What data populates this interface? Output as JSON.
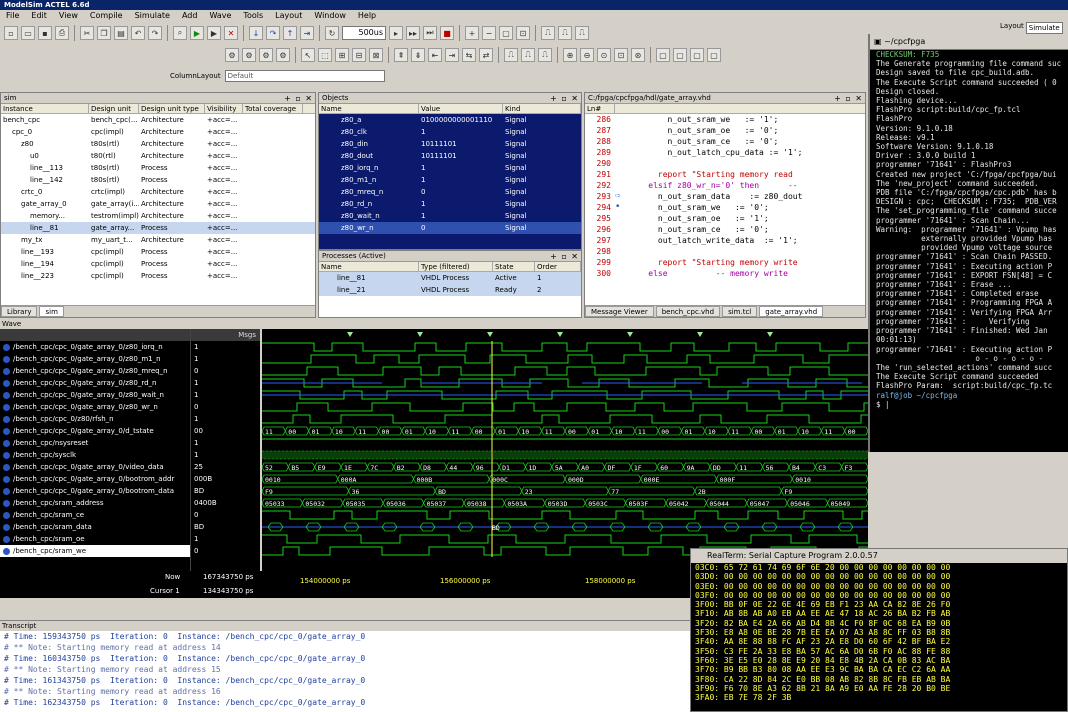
{
  "app": {
    "title": "ModelSim ACTEL 6.6d"
  },
  "menu": [
    "File",
    "Edit",
    "View",
    "Compile",
    "Simulate",
    "Add",
    "Wave",
    "Tools",
    "Layout",
    "Window",
    "Help"
  ],
  "toolbar": {
    "run_length": "500us",
    "column_layout_label": "ColumnLayout",
    "column_layout_value": "Default",
    "layout_label": "Layout",
    "layout_value": "Simulate"
  },
  "sim_pane": {
    "title": "sim",
    "columns": [
      "Instance",
      "Design unit",
      "Design unit type",
      "Visibility",
      "Total coverage"
    ],
    "rows": [
      [
        "bench_cpc",
        "bench_cpc(...",
        "Architecture",
        "+acc=...",
        ""
      ],
      [
        "cpc_0",
        "cpc(impl)",
        "Architecture",
        "+acc=...",
        ""
      ],
      [
        "z80",
        "t80s(rtl)",
        "Architecture",
        "+acc=...",
        ""
      ],
      [
        "u0",
        "t80(rtl)",
        "Architecture",
        "+acc=...",
        ""
      ],
      [
        "line__113",
        "t80s(rtl)",
        "Process",
        "+acc=...",
        ""
      ],
      [
        "line__142",
        "t80s(rtl)",
        "Process",
        "+acc=...",
        ""
      ],
      [
        "crtc_0",
        "crtc(impl)",
        "Architecture",
        "+acc=...",
        ""
      ],
      [
        "gate_array_0",
        "gate_array(i...",
        "Architecture",
        "+acc=...",
        ""
      ],
      [
        "memory...",
        "testrom(impl)",
        "Architecture",
        "+acc=...",
        ""
      ],
      [
        "line__81",
        "gate_array...",
        "Process",
        "+acc=...",
        ""
      ],
      [
        "my_tx",
        "my_uart_t...",
        "Architecture",
        "+acc=...",
        ""
      ],
      [
        "line__193",
        "cpc(impl)",
        "Process",
        "+acc=...",
        ""
      ],
      [
        "line__194",
        "cpc(impl)",
        "Process",
        "+acc=...",
        ""
      ],
      [
        "line__223",
        "cpc(impl)",
        "Process",
        "+acc=...",
        ""
      ]
    ],
    "tabs": [
      "Library",
      "sim"
    ]
  },
  "objects_pane": {
    "title": "Objects",
    "columns": [
      "Name",
      "Value",
      "Kind"
    ],
    "rows": [
      [
        "z80_a",
        "0100000000001110",
        "Signal"
      ],
      [
        "z80_clk",
        "1",
        "Signal"
      ],
      [
        "z80_din",
        "10111101",
        "Signal"
      ],
      [
        "z80_dout",
        "10111101",
        "Signal"
      ],
      [
        "z80_iorq_n",
        "1",
        "Signal"
      ],
      [
        "z80_m1_n",
        "1",
        "Signal"
      ],
      [
        "z80_mreq_n",
        "0",
        "Signal"
      ],
      [
        "z80_rd_n",
        "1",
        "Signal"
      ],
      [
        "z80_wait_n",
        "1",
        "Signal"
      ],
      [
        "z80_wr_n",
        "0",
        "Signal"
      ]
    ]
  },
  "processes_pane": {
    "title": "Processes (Active)",
    "columns": [
      "Name",
      "Type (filtered)",
      "State",
      "Order"
    ],
    "rows": [
      [
        "line__81",
        "VHDL Process",
        "Active",
        "1"
      ],
      [
        "line__21",
        "VHDL Process",
        "Ready",
        "2"
      ]
    ]
  },
  "source_pane": {
    "title": "C:/fpga/cpcfpga/hdl/gate_array.vhd",
    "col": "Ln#",
    "lines": [
      [
        "286",
        "        n_out_sram_we   := '1';"
      ],
      [
        "287",
        "        n_out_sram_oe   := '0';"
      ],
      [
        "288",
        "        n_out_sram_ce   := '0';"
      ],
      [
        "289",
        "        n_out_latch_cpu_data := '1';"
      ],
      [
        "290",
        ""
      ],
      [
        "291",
        "      report \"Starting memory read"
      ],
      [
        "292",
        "    elsif z80_wr_n='0' then      --"
      ],
      [
        "293",
        "      n_out_sram_data    := z80_dout"
      ],
      [
        "294",
        "      n_out_sram_we   := '0';"
      ],
      [
        "295",
        "      n_out_sram_oe   := '1';"
      ],
      [
        "296",
        "      n_out_sram_ce   := '0';"
      ],
      [
        "297",
        "      out_latch_write_data  := '1';"
      ],
      [
        "298",
        ""
      ],
      [
        "299",
        "      report \"Starting memory write"
      ],
      [
        "300",
        "    else          -- memory write"
      ]
    ],
    "tabs": [
      "Message Viewer",
      "bench_cpc.vhd",
      "sim.tcl",
      "gate_array.vhd"
    ]
  },
  "wave": {
    "title": "Wave",
    "msgs_label": "Msgs",
    "signals": [
      [
        "/bench_cpc/cpc_0/gate_array_0/z80_iorq_n",
        "1"
      ],
      [
        "/bench_cpc/cpc_0/gate_array_0/z80_m1_n",
        "1"
      ],
      [
        "/bench_cpc/cpc_0/gate_array_0/z80_mreq_n",
        "0"
      ],
      [
        "/bench_cpc/cpc_0/gate_array_0/z80_rd_n",
        "1"
      ],
      [
        "/bench_cpc/cpc_0/gate_array_0/z80_wait_n",
        "1"
      ],
      [
        "/bench_cpc/cpc_0/gate_array_0/z80_wr_n",
        "0"
      ],
      [
        "/bench_cpc/cpc_0/z80/rfsh_n",
        "1"
      ],
      [
        "/bench_cpc/cpc_0/gate_array_0/d_tstate",
        "00"
      ],
      [
        "/bench_cpc/nsysreset",
        "1"
      ],
      [
        "/bench_cpc/sysclk",
        "1"
      ],
      [
        "/bench_cpc/cpc_0/gate_array_0/video_data",
        "25"
      ],
      [
        "/bench_cpc/cpc_0/gate_array_0/bootrom_addr",
        "000B"
      ],
      [
        "/bench_cpc/cpc_0/gate_array_0/bootrom_data",
        "BD"
      ],
      [
        "/bench_cpc/sram_address",
        "0400B"
      ],
      [
        "/bench_cpc/sram_ce",
        "0"
      ],
      [
        "/bench_cpc/sram_data",
        "BD"
      ],
      [
        "/bench_cpc/sram_oe",
        "1"
      ],
      [
        "/bench_cpc/sram_we",
        "0"
      ]
    ],
    "now_label": "Now",
    "now_value": "167343750 ps",
    "cursor_label": "Cursor 1",
    "cursor_value": "134343750 ps",
    "timeline": [
      "154000000 ps",
      "156000000 ps",
      "158000000 ps"
    ],
    "bus_labels": {
      "d_tstate": [
        "11",
        "00",
        "01",
        "10",
        "11",
        "00",
        "01",
        "10",
        "11",
        "00",
        "01",
        "10",
        "11",
        "00",
        "01",
        "10",
        "11",
        "00",
        "01",
        "10",
        "11",
        "00",
        "01",
        "10",
        "11",
        "00"
      ],
      "video_data": [
        "52",
        "B5",
        "E9",
        "1E",
        "7C",
        "B2",
        "D8",
        "44",
        "96",
        "D1",
        "1D",
        "5A",
        "A0",
        "DF",
        "1F",
        "60",
        "9A",
        "DD",
        "11",
        "56",
        "B4",
        "C3",
        "F3"
      ],
      "bootrom_addr": [
        "0010",
        "000A",
        "000B",
        "000C",
        "000D",
        "000E",
        "000F",
        "0010"
      ],
      "bootrom_data": [
        "F9",
        "36",
        "BD",
        "23",
        "77",
        "2B",
        "F9"
      ],
      "sram_address": [
        "05033",
        "05032",
        "05035",
        "05036",
        "05037",
        "05038",
        "0503A",
        "0503D",
        "0503C",
        "0503F",
        "05042",
        "05044",
        "05047",
        "05046",
        "05049"
      ],
      "sram_data": [
        "BD"
      ]
    }
  },
  "transcript": {
    "title": "Transcript",
    "lines": [
      "# Time: 159343750 ps  Iteration: 0  Instance: /bench_cpc/cpc_0/gate_array_0",
      "# ** Note: Starting memory read at address 14",
      "# Time: 160343750 ps  Iteration: 0  Instance: /bench_cpc/cpc_0/gate_array_0",
      "# ** Note: Starting memory read at address 15",
      "# Time: 161343750 ps  Iteration: 0  Instance: /bench_cpc/cpc_0/gate_array_0",
      "# ** Note: Starting memory read at address 16",
      "# Time: 162343750 ps  Iteration: 0  Instance: /bench_cpc/cpc_0/gate_array_0"
    ]
  },
  "terminal": {
    "title": "~/cpcfpga",
    "lines": [
      [
        "g",
        "CHECKSUM: F735"
      ],
      [
        "",
        "The Generate programming file command suc"
      ],
      [
        "",
        "Design saved to file cpc_build.adb."
      ],
      [
        "",
        ""
      ],
      [
        "",
        "The Execute Script command succeeded ( 0"
      ],
      [
        "",
        "Design closed."
      ],
      [
        "",
        ""
      ],
      [
        "",
        "Flashing device..."
      ],
      [
        "",
        "FlashPro script:build/cpc_fp.tcl"
      ],
      [
        "",
        "FlashPro"
      ],
      [
        "",
        "Version: 9.1.0.18"
      ],
      [
        "",
        "Release: v9.1"
      ],
      [
        "",
        ""
      ],
      [
        "",
        "Software Version: 9.1.0.18"
      ],
      [
        "",
        "Driver : 3.0.0 build 1"
      ],
      [
        "",
        "programmer '71641' : FlashPro3"
      ],
      [
        "",
        "Created new project 'C:/fpga/cpcfpga/bui"
      ],
      [
        "",
        "The 'new_project' command succeeded."
      ],
      [
        "",
        "PDB file 'C:/fpga/cpcfpga/cpc.pdb' has b"
      ],
      [
        "",
        "DESIGN : cpc;  CHECKSUM : F735;  PDB_VER"
      ],
      [
        "",
        "The 'set_programming_file' command succe"
      ],
      [
        "",
        "programmer '71641' : Scan Chain..."
      ],
      [
        "",
        "Warning:  programmer '71641' : Vpump has"
      ],
      [
        "",
        "          externally provided Vpump has"
      ],
      [
        "",
        "          provided Vpump voltage source"
      ],
      [
        "",
        "programmer '71641' : Scan Chain PASSED."
      ],
      [
        "",
        "programmer '71641' : Executing action P"
      ],
      [
        "",
        "programmer '71641' : EXPORT FSN[48] = C"
      ],
      [
        "",
        "programmer '71641' : Erase ..."
      ],
      [
        "",
        "programmer '71641' : Completed erase"
      ],
      [
        "",
        "programmer '71641' : Programming FPGA A"
      ],
      [
        "",
        "programmer '71641' : Verifying FPGA Arr"
      ],
      [
        "",
        "programmer '71641' :     Verifying"
      ],
      [
        "",
        "programmer '71641' : Finished: Wed Jan"
      ],
      [
        "",
        "00:01:13)"
      ],
      [
        "",
        "programmer '71641' : Executing action P"
      ],
      [
        "",
        ""
      ],
      [
        "",
        "                      o - o - o - o -"
      ],
      [
        "",
        ""
      ],
      [
        "",
        "The 'run_selected_actions' command succ"
      ],
      [
        "",
        "The Execute Script command succeeded"
      ],
      [
        "",
        "FlashPro Param:  script:build/cpc_fp.tc"
      ],
      [
        "",
        ""
      ],
      [
        "c",
        "ralf@job ~/cpcfpga"
      ],
      [
        "",
        "$ |"
      ]
    ]
  },
  "realterm": {
    "title": "RealTerm: Serial Capture Program 2.0.0.57",
    "lines": [
      "03C0: 65 72 61 74 69 6F 6E 20 00 00 00 00 00 00 00 00",
      "03D0: 00 00 00 00 00 00 00 00 00 00 00 00 00 00 00 00",
      "03E0: 00 00 00 00 00 00 00 00 00 00 00 00 00 00 00 00",
      "03F0: 00 00 00 00 00 00 00 00 00 00 00 00 00 00 00 00",
      "",
      "3F00: BB 0F 0E 22 6E 4E 69 EB F1 23 AA CA 82 8E 26 F0",
      "3F10: AB 8B AB A0 EB AA EE AE 47 18 AC 26 BA B2 FB AB",
      "3F20: 82 BA E4 2A 66 AB D4 8B 4C F0 8F 0C 68 EA B9 0B",
      "3F30: E8 A8 0E BE 28 7B EE EA 07 A3 A8 8C FF 03 B8 8B",
      "3F40: AA 8E 88 88 FC AF 23 2A E8 D0 60 6F 42 BF BA E2",
      "3F50: C3 FE 2A 33 E8 BA 57 AC 6A D0 6B F0 AC 88 FE 88",
      "3F60: 3E E5 E0 28 8E E9 20 84 E8 4B 2A CA 0B 83 AC BA",
      "3F70: B9 BB B3 80 08 AA EE E3 9C BA BA CA EC C2 6A AA",
      "3F80: CA 22 8D 84 2C E0 BB 08 AB 82 8B 8C FB EB AB BA",
      "3F90: F6 70 8E A3 62 8B 21 8A A9 E0 AA FE 28 20 B0 BE",
      "3FA0: EB 7E 78 2F 3B"
    ]
  },
  "colors": {
    "wave_green": "#19d219",
    "wave_blue": "#2d5cff",
    "cursor_yellow": "#ffff40"
  }
}
